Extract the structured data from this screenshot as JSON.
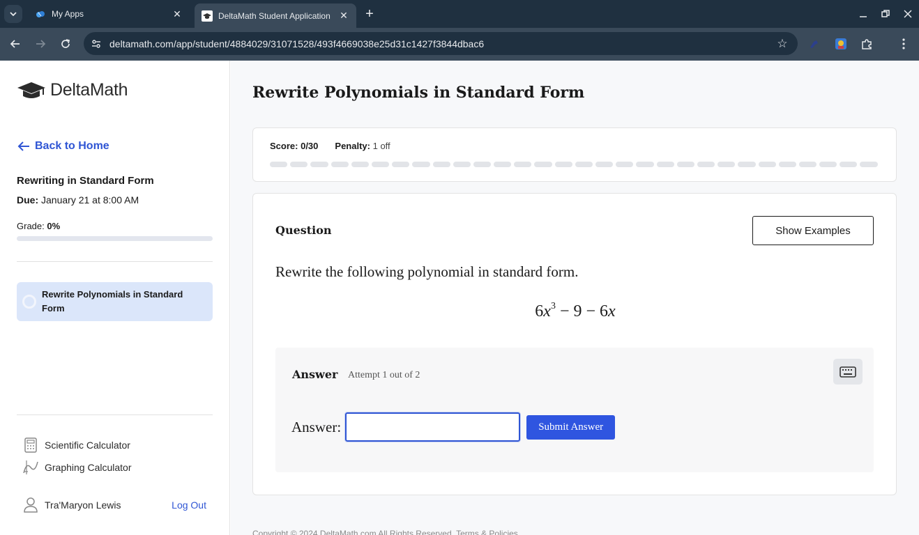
{
  "browser": {
    "tabs": [
      {
        "title": "My Apps",
        "active": false
      },
      {
        "title": "DeltaMath Student Application",
        "active": true
      }
    ],
    "url": "deltamath.com/app/student/4884029/31071528/493f4669038e25d31c1427f3844dbac6"
  },
  "sidebar": {
    "logo_text": "DeltaMath",
    "back_label": "Back to Home",
    "assignment_title": "Rewriting in Standard Form",
    "due_label": "Due:",
    "due_value": "January 21 at 8:00 AM",
    "grade_label": "Grade:",
    "grade_value": "0%",
    "grade_fraction": 0,
    "skills": [
      {
        "label": "Rewrite Polynomials in Standard Form"
      }
    ],
    "tools": [
      {
        "label": "Scientific Calculator",
        "icon": "calculator-icon"
      },
      {
        "label": "Graphing Calculator",
        "icon": "graph-icon"
      }
    ],
    "user_name": "Tra'Maryon Lewis",
    "logout_label": "Log Out"
  },
  "main": {
    "page_title": "Rewrite Polynomials in Standard Form",
    "score_label": "Score:",
    "score_value": "0/30",
    "penalty_label": "Penalty:",
    "penalty_value": "1 off",
    "progress_segments": 30,
    "progress_completed": 0,
    "question_label": "Question",
    "show_examples_label": "Show Examples",
    "question_text": "Rewrite the following polynomial in standard form.",
    "expression": {
      "coef1": "6",
      "var1": "x",
      "exp1": "3",
      "op1": "−",
      "const": "9",
      "op2": "−",
      "coef2": "6",
      "var2": "x"
    },
    "answer_label": "Answer",
    "attempt_text": "Attempt 1 out of 2",
    "answer_prompt": "Answer:",
    "answer_value": "",
    "submit_label": "Submit Answer",
    "footer_text": "Copyright © 2024 DeltaMath.com All Rights Reserved. Terms & Policies"
  },
  "colors": {
    "accent": "#2f55d4",
    "skill_highlight": "#dbe6fa",
    "chrome_dark": "#1f3040",
    "chrome_toolbar": "#3a4a5a"
  }
}
